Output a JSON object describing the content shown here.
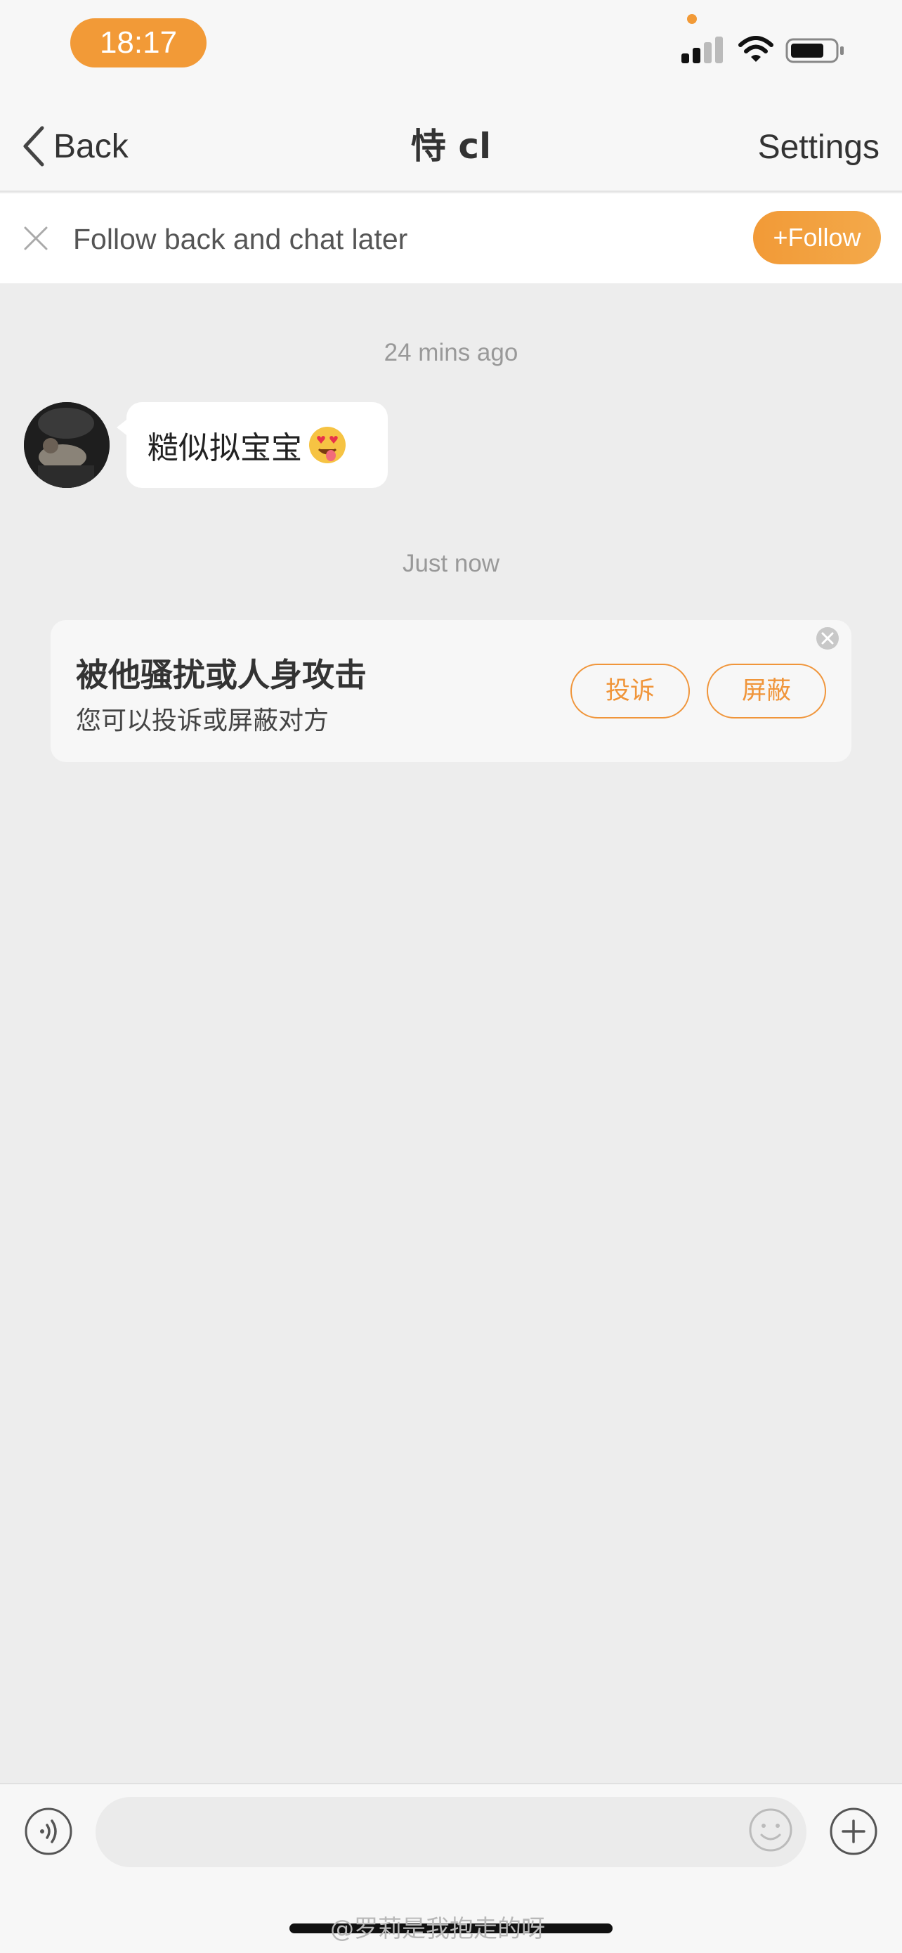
{
  "status_bar": {
    "time": "18:17",
    "accent_color": "#f29a37"
  },
  "nav": {
    "back_label": "Back",
    "title": "恃 cl",
    "settings_label": "Settings"
  },
  "follow_banner": {
    "text": "Follow back and chat later",
    "follow_label": "+Follow"
  },
  "messages": [
    {
      "timestamp": "24 mins ago",
      "sender": "other",
      "text": "糙似拟宝宝",
      "emoji": "heart-eyes-tongue-emoji"
    }
  ],
  "notice": {
    "timestamp": "Just now",
    "title": "被他骚扰或人身攻击",
    "subtitle": "您可以投诉或屏蔽对方",
    "report_label": "投诉",
    "block_label": "屏蔽"
  },
  "input": {
    "placeholder": ""
  },
  "watermark": "@罗莉是我抱走的呀"
}
